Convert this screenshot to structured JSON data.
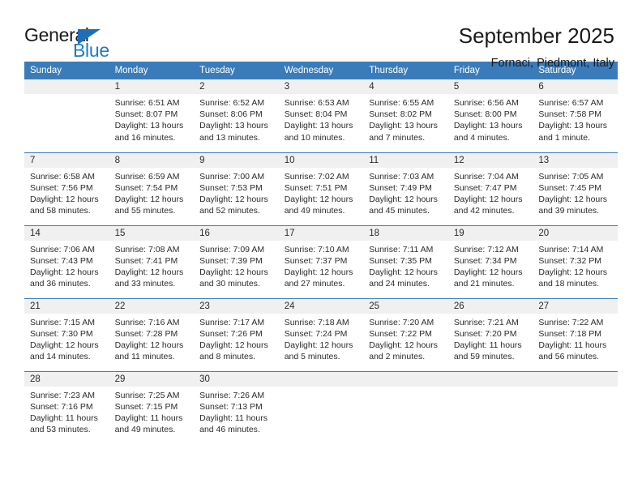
{
  "logo": {
    "word_top": "General",
    "word_bottom": "Blue",
    "accent_color": "#1e7bc4",
    "triangle_color": "#1e6fb8"
  },
  "header": {
    "title": "September 2025",
    "subtitle": "Fornaci, Piedmont, Italy"
  },
  "theme": {
    "header_blue": "#3a7cba",
    "daynum_band": "#f0f0f0",
    "text": "#2b2b2b"
  },
  "weekday_headers": [
    "Sunday",
    "Monday",
    "Tuesday",
    "Wednesday",
    "Thursday",
    "Friday",
    "Saturday"
  ],
  "weeks": [
    [
      {
        "day": "",
        "empty": true,
        "sunrise": "",
        "sunset": "",
        "daylight": ""
      },
      {
        "day": "1",
        "sunrise": "Sunrise: 6:51 AM",
        "sunset": "Sunset: 8:07 PM",
        "daylight": "Daylight: 13 hours and 16 minutes."
      },
      {
        "day": "2",
        "sunrise": "Sunrise: 6:52 AM",
        "sunset": "Sunset: 8:06 PM",
        "daylight": "Daylight: 13 hours and 13 minutes."
      },
      {
        "day": "3",
        "sunrise": "Sunrise: 6:53 AM",
        "sunset": "Sunset: 8:04 PM",
        "daylight": "Daylight: 13 hours and 10 minutes."
      },
      {
        "day": "4",
        "sunrise": "Sunrise: 6:55 AM",
        "sunset": "Sunset: 8:02 PM",
        "daylight": "Daylight: 13 hours and 7 minutes."
      },
      {
        "day": "5",
        "sunrise": "Sunrise: 6:56 AM",
        "sunset": "Sunset: 8:00 PM",
        "daylight": "Daylight: 13 hours and 4 minutes."
      },
      {
        "day": "6",
        "sunrise": "Sunrise: 6:57 AM",
        "sunset": "Sunset: 7:58 PM",
        "daylight": "Daylight: 13 hours and 1 minute."
      }
    ],
    [
      {
        "day": "7",
        "sunrise": "Sunrise: 6:58 AM",
        "sunset": "Sunset: 7:56 PM",
        "daylight": "Daylight: 12 hours and 58 minutes."
      },
      {
        "day": "8",
        "sunrise": "Sunrise: 6:59 AM",
        "sunset": "Sunset: 7:54 PM",
        "daylight": "Daylight: 12 hours and 55 minutes."
      },
      {
        "day": "9",
        "sunrise": "Sunrise: 7:00 AM",
        "sunset": "Sunset: 7:53 PM",
        "daylight": "Daylight: 12 hours and 52 minutes."
      },
      {
        "day": "10",
        "sunrise": "Sunrise: 7:02 AM",
        "sunset": "Sunset: 7:51 PM",
        "daylight": "Daylight: 12 hours and 49 minutes."
      },
      {
        "day": "11",
        "sunrise": "Sunrise: 7:03 AM",
        "sunset": "Sunset: 7:49 PM",
        "daylight": "Daylight: 12 hours and 45 minutes."
      },
      {
        "day": "12",
        "sunrise": "Sunrise: 7:04 AM",
        "sunset": "Sunset: 7:47 PM",
        "daylight": "Daylight: 12 hours and 42 minutes."
      },
      {
        "day": "13",
        "sunrise": "Sunrise: 7:05 AM",
        "sunset": "Sunset: 7:45 PM",
        "daylight": "Daylight: 12 hours and 39 minutes."
      }
    ],
    [
      {
        "day": "14",
        "sunrise": "Sunrise: 7:06 AM",
        "sunset": "Sunset: 7:43 PM",
        "daylight": "Daylight: 12 hours and 36 minutes."
      },
      {
        "day": "15",
        "sunrise": "Sunrise: 7:08 AM",
        "sunset": "Sunset: 7:41 PM",
        "daylight": "Daylight: 12 hours and 33 minutes."
      },
      {
        "day": "16",
        "sunrise": "Sunrise: 7:09 AM",
        "sunset": "Sunset: 7:39 PM",
        "daylight": "Daylight: 12 hours and 30 minutes."
      },
      {
        "day": "17",
        "sunrise": "Sunrise: 7:10 AM",
        "sunset": "Sunset: 7:37 PM",
        "daylight": "Daylight: 12 hours and 27 minutes."
      },
      {
        "day": "18",
        "sunrise": "Sunrise: 7:11 AM",
        "sunset": "Sunset: 7:35 PM",
        "daylight": "Daylight: 12 hours and 24 minutes."
      },
      {
        "day": "19",
        "sunrise": "Sunrise: 7:12 AM",
        "sunset": "Sunset: 7:34 PM",
        "daylight": "Daylight: 12 hours and 21 minutes."
      },
      {
        "day": "20",
        "sunrise": "Sunrise: 7:14 AM",
        "sunset": "Sunset: 7:32 PM",
        "daylight": "Daylight: 12 hours and 18 minutes."
      }
    ],
    [
      {
        "day": "21",
        "sunrise": "Sunrise: 7:15 AM",
        "sunset": "Sunset: 7:30 PM",
        "daylight": "Daylight: 12 hours and 14 minutes."
      },
      {
        "day": "22",
        "sunrise": "Sunrise: 7:16 AM",
        "sunset": "Sunset: 7:28 PM",
        "daylight": "Daylight: 12 hours and 11 minutes."
      },
      {
        "day": "23",
        "sunrise": "Sunrise: 7:17 AM",
        "sunset": "Sunset: 7:26 PM",
        "daylight": "Daylight: 12 hours and 8 minutes."
      },
      {
        "day": "24",
        "sunrise": "Sunrise: 7:18 AM",
        "sunset": "Sunset: 7:24 PM",
        "daylight": "Daylight: 12 hours and 5 minutes."
      },
      {
        "day": "25",
        "sunrise": "Sunrise: 7:20 AM",
        "sunset": "Sunset: 7:22 PM",
        "daylight": "Daylight: 12 hours and 2 minutes."
      },
      {
        "day": "26",
        "sunrise": "Sunrise: 7:21 AM",
        "sunset": "Sunset: 7:20 PM",
        "daylight": "Daylight: 11 hours and 59 minutes."
      },
      {
        "day": "27",
        "sunrise": "Sunrise: 7:22 AM",
        "sunset": "Sunset: 7:18 PM",
        "daylight": "Daylight: 11 hours and 56 minutes."
      }
    ],
    [
      {
        "day": "28",
        "sunrise": "Sunrise: 7:23 AM",
        "sunset": "Sunset: 7:16 PM",
        "daylight": "Daylight: 11 hours and 53 minutes."
      },
      {
        "day": "29",
        "sunrise": "Sunrise: 7:25 AM",
        "sunset": "Sunset: 7:15 PM",
        "daylight": "Daylight: 11 hours and 49 minutes."
      },
      {
        "day": "30",
        "sunrise": "Sunrise: 7:26 AM",
        "sunset": "Sunset: 7:13 PM",
        "daylight": "Daylight: 11 hours and 46 minutes."
      },
      {
        "day": "",
        "empty": true,
        "sunrise": "",
        "sunset": "",
        "daylight": ""
      },
      {
        "day": "",
        "empty": true,
        "sunrise": "",
        "sunset": "",
        "daylight": ""
      },
      {
        "day": "",
        "empty": true,
        "sunrise": "",
        "sunset": "",
        "daylight": ""
      },
      {
        "day": "",
        "empty": true,
        "sunrise": "",
        "sunset": "",
        "daylight": ""
      }
    ]
  ]
}
